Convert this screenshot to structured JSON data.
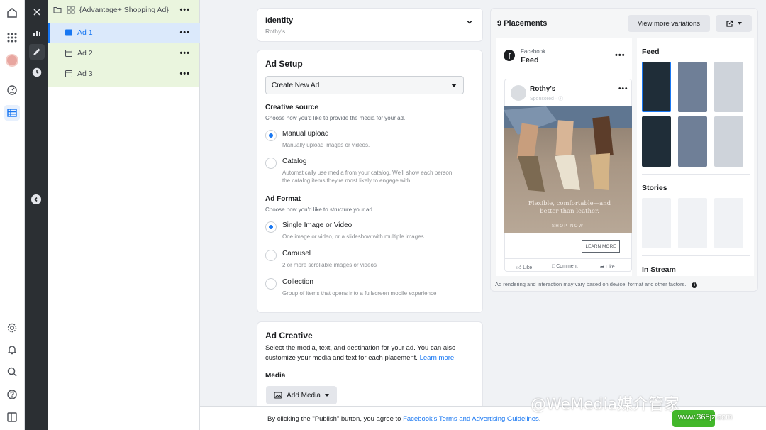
{
  "tree": {
    "campaign_label": "{Advantage+ Shopping Ad}",
    "ads": [
      {
        "label": "Ad 1",
        "selected": true
      },
      {
        "label": "Ad 2",
        "selected": false
      },
      {
        "label": "Ad 3",
        "selected": false
      }
    ],
    "more": "•••"
  },
  "identity": {
    "title": "Identity",
    "value": "Rothy's"
  },
  "ad_setup": {
    "title": "Ad Setup",
    "select_value": "Create New Ad",
    "creative_source": {
      "title": "Creative source",
      "subtitle": "Choose how you'd like to provide the media for your ad.",
      "options": [
        {
          "label": "Manual upload",
          "desc": "Manually upload images or videos.",
          "selected": true
        },
        {
          "label": "Catalog",
          "desc": "Automatically use media from your catalog. We'll show each person the catalog items they're most likely to engage with.",
          "selected": false
        }
      ]
    },
    "ad_format": {
      "title": "Ad Format",
      "subtitle": "Choose how you'd like to structure your ad.",
      "options": [
        {
          "label": "Single Image or Video",
          "desc": "One image or video, or a slideshow with multiple images",
          "selected": true
        },
        {
          "label": "Carousel",
          "desc": "2 or more scrollable images or videos",
          "selected": false
        },
        {
          "label": "Collection",
          "desc": "Group of items that opens into a fullscreen mobile experience",
          "selected": false
        }
      ]
    }
  },
  "ad_creative": {
    "title": "Ad Creative",
    "desc": "Select the media, text, and destination for your ad. You can also customize your media and text for each placement.",
    "learn_more": "Learn more",
    "media_label": "Media",
    "add_media": "Add Media"
  },
  "preview": {
    "title": "9 Placements",
    "view_more": "View more variations",
    "platform": "Facebook",
    "placement": "Feed",
    "page_name": "Rothy's",
    "sponsored": "Sponsored · ⓘ",
    "image_text": "Flexible, comfortable—and better than leather.",
    "shop_now": "SHOP NOW",
    "cta": "LEARN MORE",
    "actions": [
      "Like",
      "Comment",
      "Like"
    ],
    "note": "Ad rendering and interaction may vary based on device, format and other factors.",
    "sections": [
      "Feed",
      "Stories",
      "In Stream"
    ]
  },
  "footer": {
    "text": "By clicking the \"Publish\" button, you agree to",
    "link": "Facebook's Terms and Advertising Guidelines",
    "dot": "."
  },
  "watermark": {
    "text": "@WeMedia媒介管家",
    "site": "www.365jz.com"
  },
  "colors": {
    "accent": "#1877f2",
    "publish": "#42b72a",
    "tree_bg": "#eaf5de"
  }
}
